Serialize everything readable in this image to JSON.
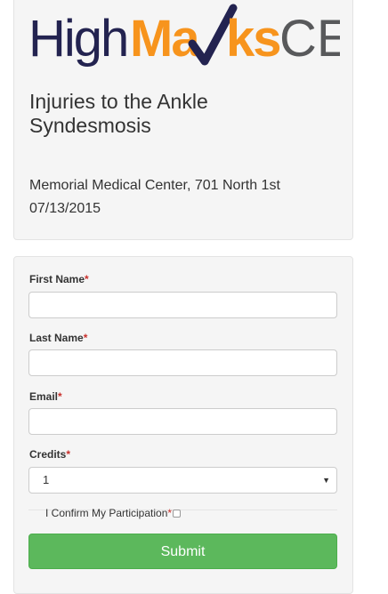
{
  "logo": {
    "text": "HighMarks CE",
    "part_high": "High",
    "part_marks_a": "Ma",
    "part_marks_b": "ks",
    "part_ce": "CE"
  },
  "event": {
    "title": "Injuries to the Ankle Syndesmosis",
    "location": "Memorial Medical Center, 701 North 1st",
    "date": "07/13/2015"
  },
  "form": {
    "first_name_label": "First Name",
    "last_name_label": "Last Name",
    "email_label": "Email",
    "credits_label": "Credits",
    "required_mark": "*",
    "first_name_value": "",
    "last_name_value": "",
    "email_value": "",
    "credits_selected": "1",
    "confirm_label": "I Confirm My Participation",
    "confirm_checked": false,
    "submit_label": "Submit"
  },
  "colors": {
    "logo_dark": "#232350",
    "logo_orange": "#f7941d",
    "logo_gray": "#58595b",
    "submit_green": "#5cb85c",
    "required_red": "#c9302c"
  }
}
